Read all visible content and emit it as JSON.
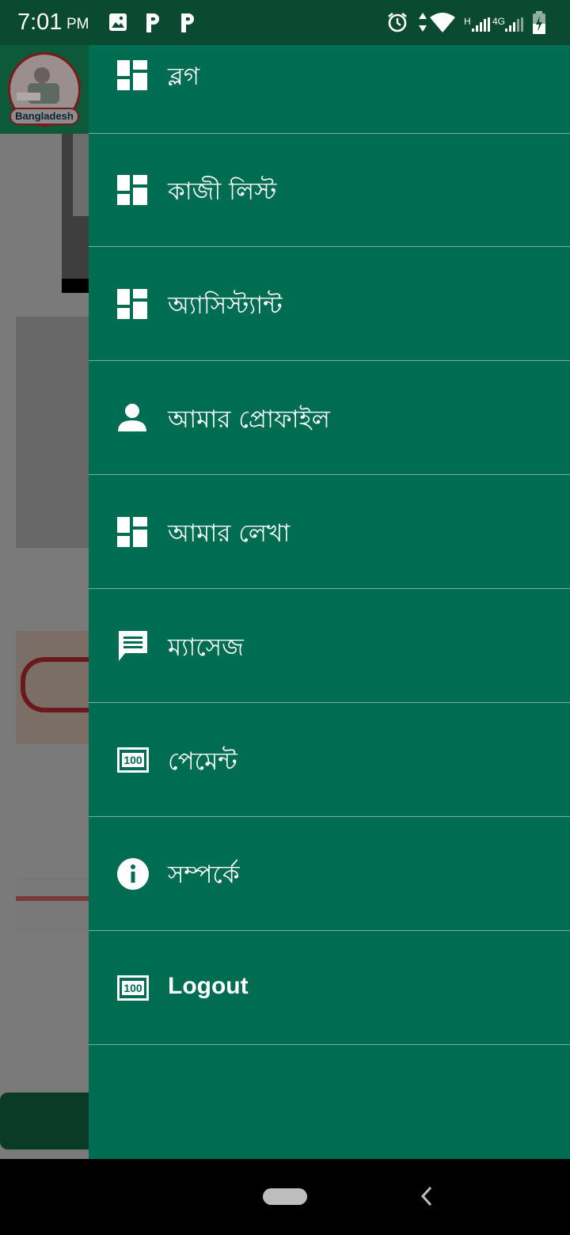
{
  "status_bar": {
    "time": "7:01",
    "ampm": "PM",
    "network_h": "H",
    "network_4g": "4G"
  },
  "background": {
    "logo_text": "Bangladesh"
  },
  "drawer": {
    "items": [
      {
        "label": "ব্লগ",
        "icon": "dashboard-icon"
      },
      {
        "label": "কাজী লিস্ট",
        "icon": "dashboard-icon"
      },
      {
        "label": "অ্যাসিস্ট্যান্ট",
        "icon": "dashboard-icon"
      },
      {
        "label": "আমার প্রোফাইল",
        "icon": "person-icon"
      },
      {
        "label": "আমার লেখা",
        "icon": "dashboard-icon"
      },
      {
        "label": "ম্যাসেজ",
        "icon": "message-icon"
      },
      {
        "label": "পেমেন্ট",
        "icon": "payment-100-icon"
      },
      {
        "label": "সম্পর্কে",
        "icon": "info-icon"
      },
      {
        "label": "Logout",
        "icon": "payment-100-icon"
      }
    ]
  },
  "colors": {
    "drawer_bg": "#006d52",
    "status_bar_bg": "#094a30",
    "divider": "rgba(255,255,255,0.45)"
  }
}
